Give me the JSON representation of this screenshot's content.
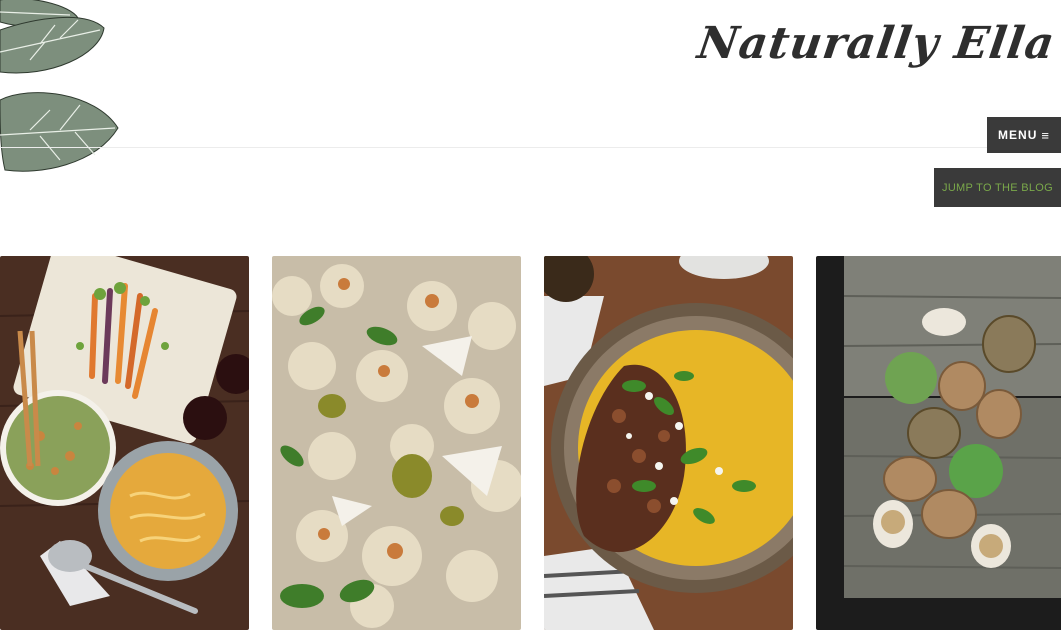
{
  "site": {
    "logo_text": "Naturally Ella"
  },
  "header": {
    "menu_label": "MENU",
    "menu_icon": "hamburger-icon",
    "blog_label": "JUMP TO THE BLOG"
  },
  "tiles": [
    {
      "name": "roasted-carrots-cauliflower-gratin-spread",
      "icon": "food-photo"
    },
    {
      "name": "roasted-cauliflower-couscous-salad",
      "icon": "food-photo"
    },
    {
      "name": "polenta-bean-bowl",
      "icon": "food-photo"
    },
    {
      "name": "walnuts-on-wood-board",
      "icon": "food-photo"
    }
  ],
  "colors": {
    "button_bg": "#3a3a3a",
    "blog_text": "#7aa84a",
    "logo": "#2e2e2e"
  }
}
